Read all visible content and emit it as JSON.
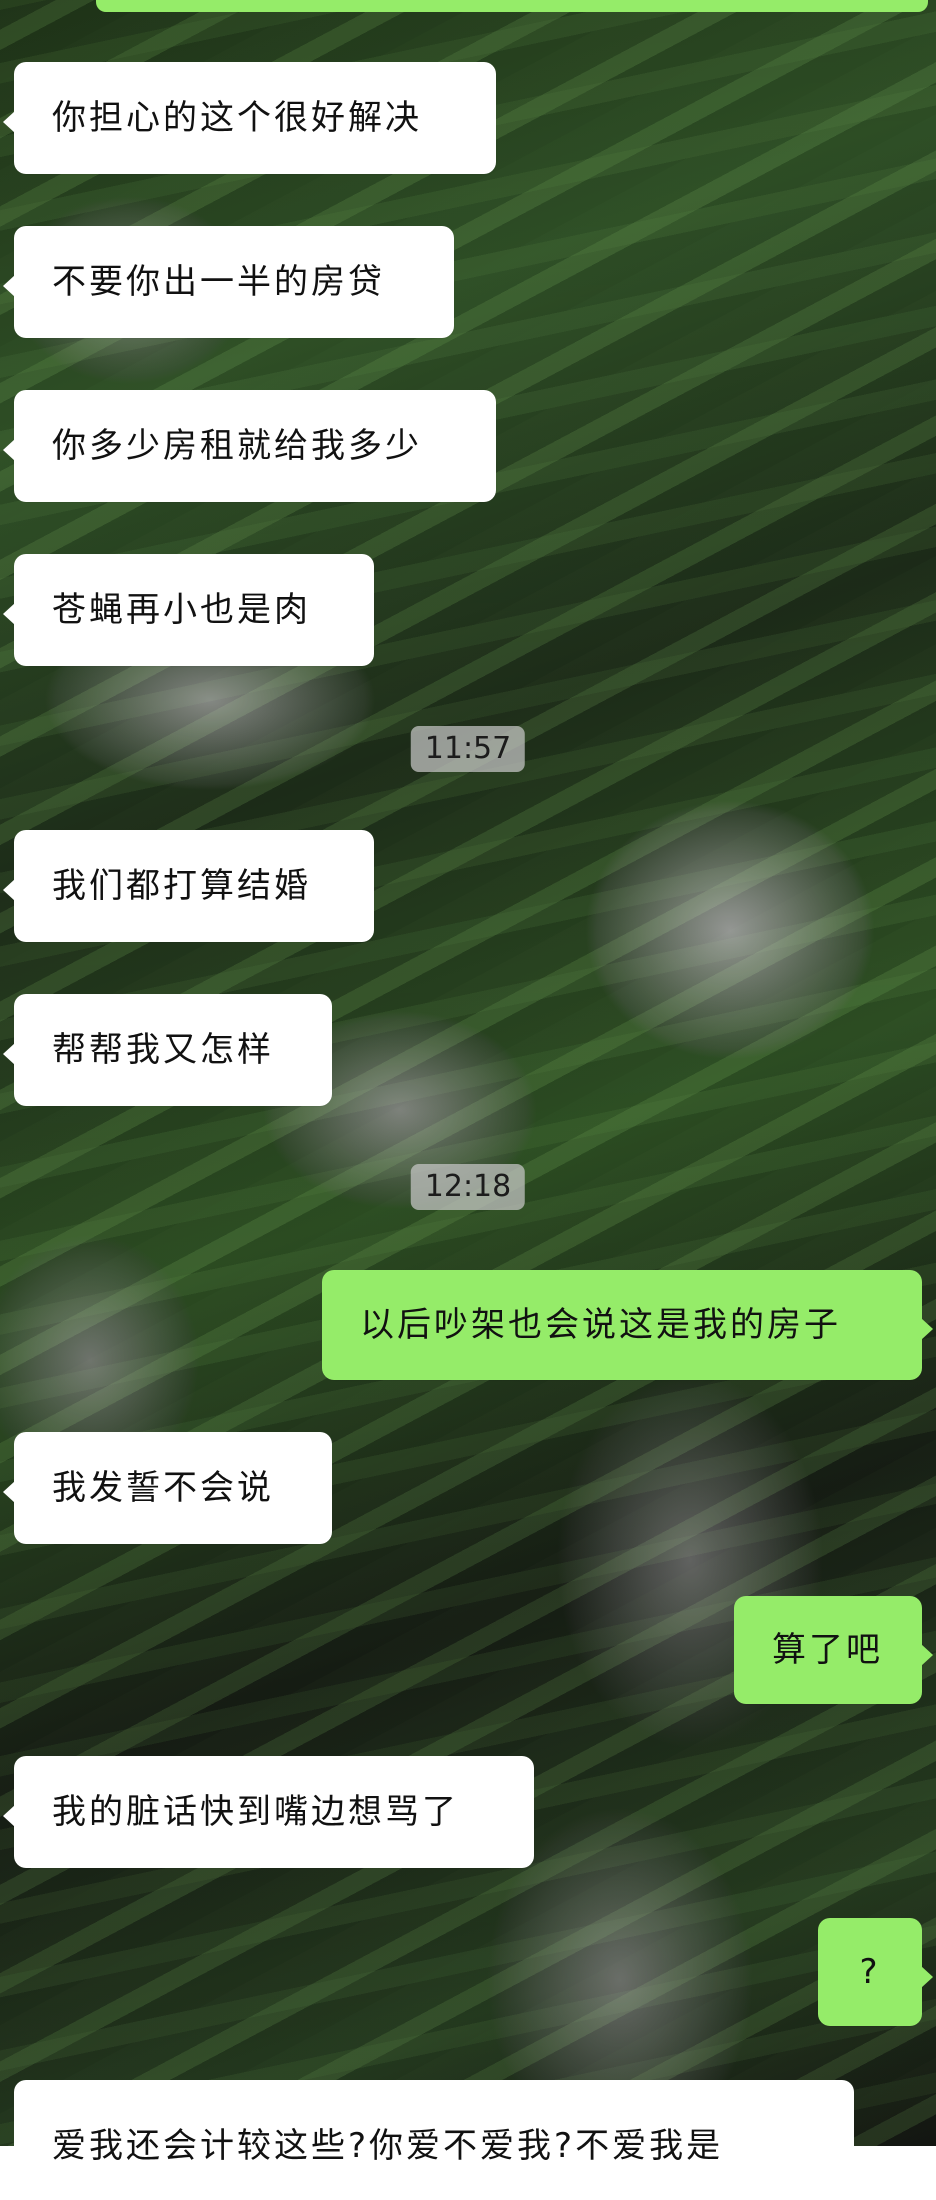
{
  "messages": [
    {
      "text": "你担心的这个很好解决",
      "side": "incoming"
    },
    {
      "text": "不要你出一半的房贷",
      "side": "incoming"
    },
    {
      "text": "你多少房租就给我多少",
      "side": "incoming"
    },
    {
      "text": "苍蝇再小也是肉",
      "side": "incoming"
    },
    {
      "text": "11:57",
      "kind": "time"
    },
    {
      "text": "我们都打算结婚",
      "side": "incoming"
    },
    {
      "text": "帮帮我又怎样",
      "side": "incoming"
    },
    {
      "text": "12:18",
      "kind": "time"
    },
    {
      "text": "以后吵架也会说这是我的房子",
      "side": "outgoing"
    },
    {
      "text": "我发誓不会说",
      "side": "incoming"
    },
    {
      "text": "算了吧",
      "side": "outgoing"
    },
    {
      "text": "我的脏话快到嘴边想骂了",
      "side": "incoming"
    },
    {
      "text": "?",
      "side": "outgoing"
    },
    {
      "text": "爱我还会计较这些?你爱不爱我?不爱我是",
      "side": "incoming",
      "partial": true
    }
  ]
}
